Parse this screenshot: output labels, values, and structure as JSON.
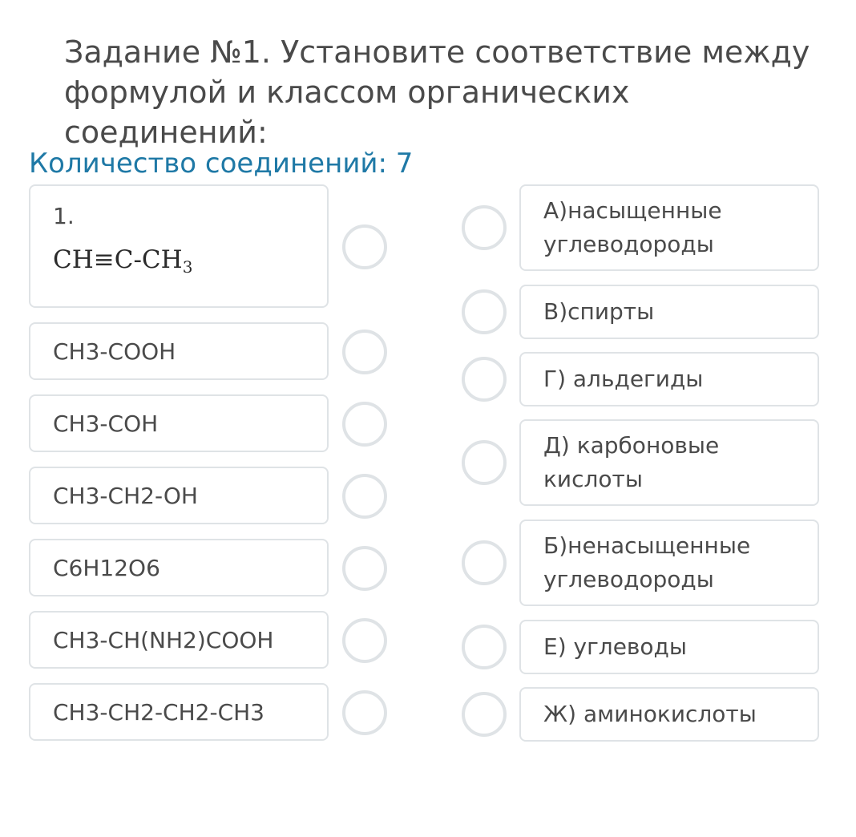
{
  "task": {
    "title": "Задание №1. Установите соответствие между формулой и классом органических соединений:",
    "count_text": "Количество соединений: 7"
  },
  "left_items": [
    {
      "number": "1.",
      "formula_image": {
        "main": "CH≡C-CH",
        "sub": "3"
      }
    },
    {
      "label": "CH3-COOH"
    },
    {
      "label": "CH3-COH"
    },
    {
      "label": "CH3-CH2-OH"
    },
    {
      "label": "C6H12O6"
    },
    {
      "label": "CH3-CH(NH2)COOH"
    },
    {
      "label": "CH3-CH2-CH2-CH3"
    }
  ],
  "right_items": [
    {
      "label": "А)насыщенные углеводороды"
    },
    {
      "label": "В)спирты"
    },
    {
      "label": "Г) альдегиды"
    },
    {
      "label": "Д) карбоновые кислоты"
    },
    {
      "label": "Б)ненасыщенные углеводороды"
    },
    {
      "label": "Е) углеводы"
    },
    {
      "label": "Ж) аминокислоты"
    }
  ],
  "colors": {
    "text": "#4a4a4a",
    "accent": "#1f79a6",
    "border": "#dfe3e6"
  }
}
